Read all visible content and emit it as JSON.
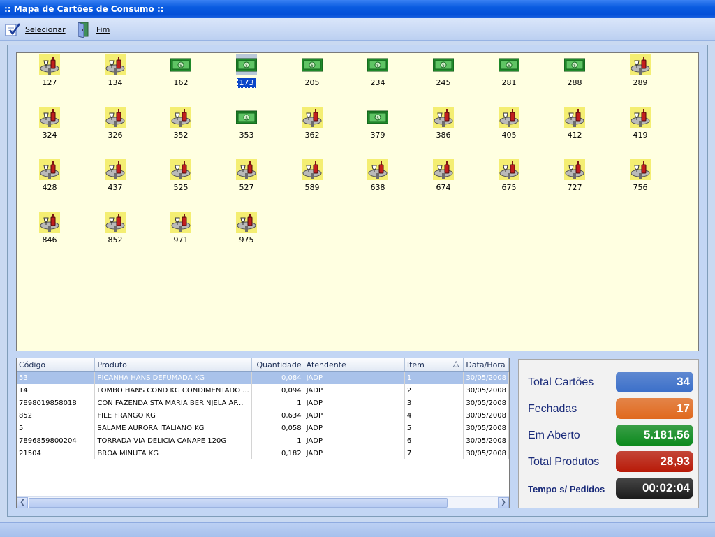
{
  "window": {
    "title": ":: Mapa de Cartões de Consumo ::"
  },
  "toolbar": {
    "select_label": "Selecionar",
    "exit_label": "Fim"
  },
  "cards": [
    {
      "number": "127",
      "type": "table"
    },
    {
      "number": "134",
      "type": "table"
    },
    {
      "number": "162",
      "type": "money"
    },
    {
      "number": "173",
      "type": "money",
      "selected": true
    },
    {
      "number": "205",
      "type": "money"
    },
    {
      "number": "234",
      "type": "money"
    },
    {
      "number": "245",
      "type": "money"
    },
    {
      "number": "281",
      "type": "money"
    },
    {
      "number": "288",
      "type": "money"
    },
    {
      "number": "289",
      "type": "table"
    },
    {
      "number": "324",
      "type": "table"
    },
    {
      "number": "326",
      "type": "table"
    },
    {
      "number": "352",
      "type": "table"
    },
    {
      "number": "353",
      "type": "money"
    },
    {
      "number": "362",
      "type": "table"
    },
    {
      "number": "379",
      "type": "money"
    },
    {
      "number": "386",
      "type": "table"
    },
    {
      "number": "405",
      "type": "table"
    },
    {
      "number": "412",
      "type": "table"
    },
    {
      "number": "419",
      "type": "table"
    },
    {
      "number": "428",
      "type": "table"
    },
    {
      "number": "437",
      "type": "table"
    },
    {
      "number": "525",
      "type": "table"
    },
    {
      "number": "527",
      "type": "table"
    },
    {
      "number": "589",
      "type": "table"
    },
    {
      "number": "638",
      "type": "table"
    },
    {
      "number": "674",
      "type": "table"
    },
    {
      "number": "675",
      "type": "table"
    },
    {
      "number": "727",
      "type": "table"
    },
    {
      "number": "756",
      "type": "table"
    },
    {
      "number": "846",
      "type": "table"
    },
    {
      "number": "852",
      "type": "table"
    },
    {
      "number": "971",
      "type": "table"
    },
    {
      "number": "975",
      "type": "table"
    }
  ],
  "grid": {
    "columns": [
      "Código",
      "Produto",
      "Quantidade",
      "Atendente",
      "Item",
      "Data/Hora"
    ],
    "sort_indicator": "△",
    "rows": [
      [
        "53",
        "PICANHA HANS DEFUMADA KG",
        "0,084",
        "JADP",
        "1",
        "30/05/2008"
      ],
      [
        "14",
        "LOMBO HANS COND KG CONDIMENTADO ...",
        "0,094",
        "JADP",
        "2",
        "30/05/2008"
      ],
      [
        "7898019858018",
        "CON FAZENDA STA MARIA BERINJELA AP...",
        "1",
        "JADP",
        "3",
        "30/05/2008"
      ],
      [
        "852",
        "FILE FRANGO KG",
        "0,634",
        "JADP",
        "4",
        "30/05/2008"
      ],
      [
        "5",
        "SALAME AURORA ITALIANO KG",
        "0,058",
        "JADP",
        "5",
        "30/05/2008"
      ],
      [
        "7896859800204",
        "TORRADA VIA DELICIA CANAPE 120G",
        "1",
        "JADP",
        "6",
        "30/05/2008"
      ],
      [
        "21504",
        "BROA MINUTA KG",
        "0,182",
        "JADP",
        "7",
        "30/05/2008"
      ]
    ]
  },
  "totals": {
    "total_cartoes": {
      "label": "Total Cartões",
      "value": "34",
      "color": "#3b6fc9"
    },
    "fechadas": {
      "label": "Fechadas",
      "value": "17",
      "color": "#e0691e"
    },
    "em_aberto": {
      "label": "Em Aberto",
      "value": "5.181,56",
      "color": "#0d8a1e"
    },
    "total_produtos": {
      "label": "Total Produtos",
      "value": "28,93",
      "color": "#b81a08"
    },
    "tempo": {
      "label": "Tempo s/ Pedidos",
      "value": "00:02:04",
      "color": "#1c1c1c"
    }
  }
}
